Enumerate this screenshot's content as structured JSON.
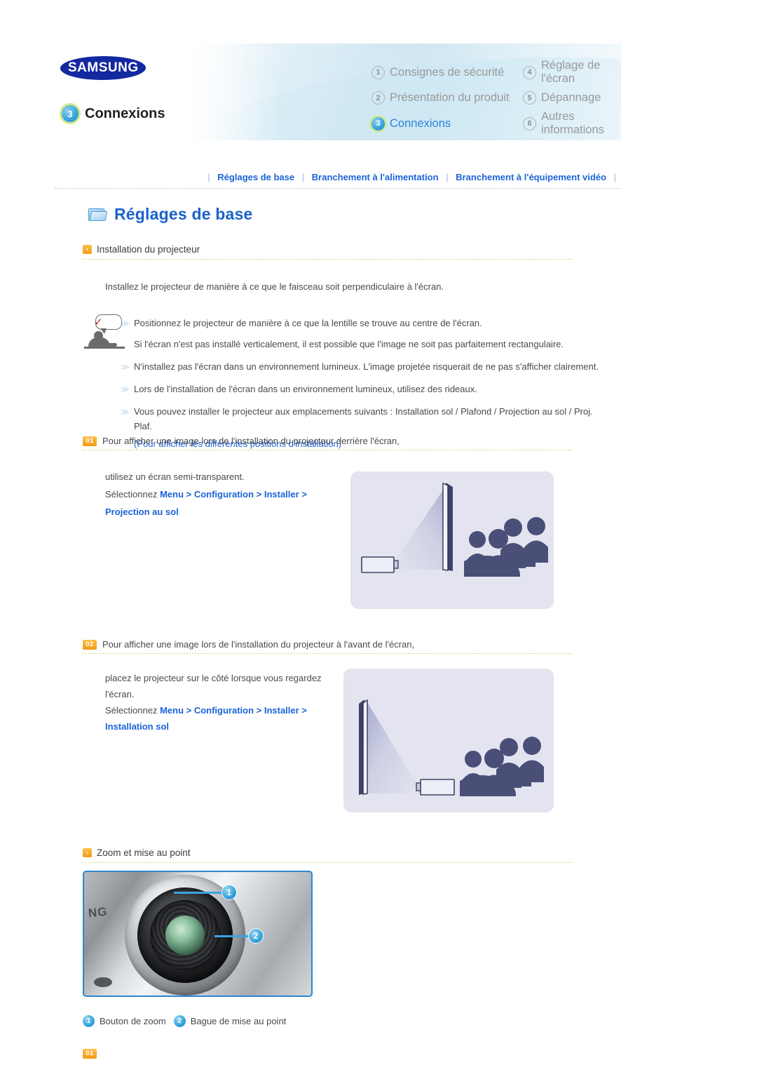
{
  "header": {
    "brand": "SAMSUNG",
    "current_chapter_number": "3",
    "current_chapter_label": "Connexions",
    "menu": [
      {
        "number": "1",
        "label": "Consignes de sécurité",
        "active": false
      },
      {
        "number": "4",
        "label": "Réglage de l'écran",
        "active": false
      },
      {
        "number": "2",
        "label": "Présentation du produit",
        "active": false
      },
      {
        "number": "5",
        "label": "Dépannage",
        "active": false
      },
      {
        "number": "3",
        "label": "Connexions",
        "active": true
      },
      {
        "number": "6",
        "label": "Autres informations",
        "active": false
      }
    ]
  },
  "subnav": {
    "items": [
      "Réglages de base",
      "Branchement à l'alimentation",
      "Branchement à l'équipement vidéo"
    ],
    "separator": "|"
  },
  "section": {
    "title": "Réglages de base"
  },
  "subsection1": {
    "badge": "›",
    "title": "Installation du projecteur",
    "intro": "Installez le projecteur de manière à ce que le faisceau soit perpendiculaire à l'écran.",
    "bullets": [
      {
        "chevron": "≫",
        "text": "Positionnez le projecteur de manière à ce que la lentille se trouve au centre de l'écran."
      },
      {
        "chevron": "",
        "text": "Si l'écran n'est pas installé verticalement, il est possible que l'image ne soit pas parfaitement rectangulaire."
      },
      {
        "chevron": "≫",
        "text": "N'installez pas l'écran dans un environnement lumineux. L'image projetée risquerait de ne pas s'afficher clairement."
      },
      {
        "chevron": "≫",
        "text": "Lors de l'installation de l'écran dans un environnement lumineux, utilisez des rideaux."
      },
      {
        "chevron": "≫",
        "text": "Vous pouvez installer le projecteur aux emplacements suivants : Installation sol / Plafond / Projection au sol / Proj. Plaf."
      }
    ],
    "link": "(Pour afficher les différentes positions d'installation)"
  },
  "step1": {
    "badge": "01",
    "heading": "Pour afficher une image lors de l'installation du projecteur derrière l'écran,",
    "line1": "utilisez un écran semi-transparent.",
    "line2_prefix": "Sélectionnez ",
    "line2_bold": "Menu > Configuration > Installer >",
    "line3_bold": "Projection au sol",
    "illustration": "rear-projection-diagram"
  },
  "step2": {
    "badge": "02",
    "heading": "Pour afficher une image lors de l'installation du projecteur à l'avant de l'écran,",
    "line1": "placez le projecteur sur le côté lorsque vous regardez",
    "line1b": "l'écran.",
    "line2_prefix": "Sélectionnez ",
    "line2_bold": "Menu > Configuration > Installer >",
    "line3_bold": "Installation sol",
    "illustration": "front-projection-diagram"
  },
  "subsection2": {
    "badge": "›",
    "title": "Zoom et mise au point",
    "photo_alt": "Projecteur Samsung - objectif",
    "callouts": [
      {
        "number": "1",
        "label": "Bouton de zoom"
      },
      {
        "number": "2",
        "label": "Bague de mise au point"
      }
    ]
  },
  "footer": {
    "badge": "01"
  },
  "colors": {
    "brand_blue": "#1428a0",
    "link_blue": "#1b63d8",
    "accent_blue": "#2a86d8",
    "badge_orange": "#f59a12",
    "rule_green": "#c2dd7e",
    "illus_bg": "#e3e4ef",
    "silhouette": "#4a4f78"
  }
}
